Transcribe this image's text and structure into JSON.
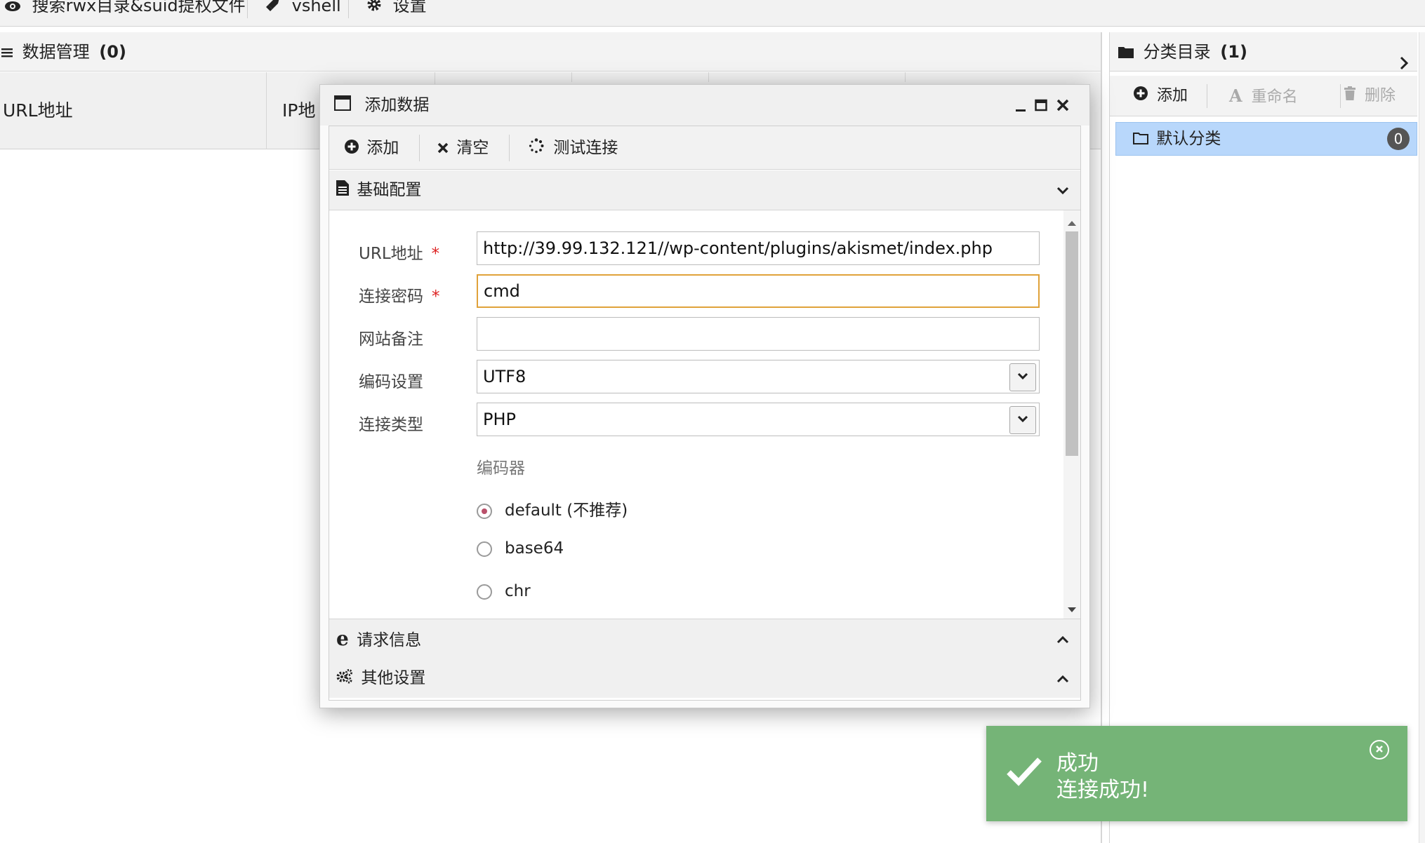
{
  "top_toolbar": {
    "items": [
      {
        "label": "搜索rwx目录&suid提权文件",
        "icon": "eye-icon"
      },
      {
        "label": "vshell",
        "icon": "rocket-icon"
      },
      {
        "label": "设置",
        "icon": "gear-icon"
      }
    ]
  },
  "data_panel": {
    "title": "数据管理",
    "count": "(0)",
    "columns": [
      "URL地址",
      "IP地"
    ]
  },
  "category_panel": {
    "title": "分类目录",
    "count": "(1)",
    "toolbar": {
      "add": "添加",
      "rename": "重命名",
      "delete": "删除"
    },
    "items": [
      {
        "label": "默认分类",
        "count": "0"
      }
    ]
  },
  "dialog": {
    "title": "添加数据",
    "toolbar": {
      "add": "添加",
      "clear": "清空",
      "test": "测试连接"
    },
    "sections": {
      "basic": "基础配置",
      "request": "请求信息",
      "other": "其他设置"
    },
    "form": {
      "url_label": "URL地址",
      "url_value": "http://39.99.132.121//wp-content/plugins/akismet/index.php",
      "password_label": "连接密码",
      "password_value": "cmd",
      "note_label": "网站备注",
      "note_value": "",
      "encoding_label": "编码设置",
      "encoding_value": "UTF8",
      "type_label": "连接类型",
      "type_value": "PHP",
      "encoder_label": "编码器",
      "encoders": [
        {
          "label": "default (不推荐)",
          "checked": true
        },
        {
          "label": "base64",
          "checked": false
        },
        {
          "label": "chr",
          "checked": false
        }
      ],
      "required_mark": "*"
    }
  },
  "toast": {
    "title": "成功",
    "message": "连接成功!",
    "color": "#75b477"
  }
}
